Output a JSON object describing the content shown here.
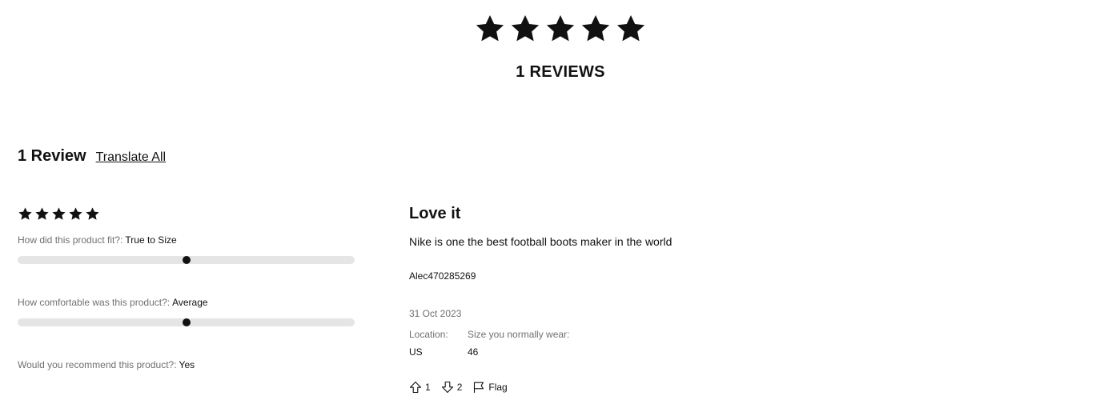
{
  "summary": {
    "rating": 5,
    "rating_max": 5,
    "count_label": "1 REVIEWS"
  },
  "reviews_section": {
    "title": "1 Review",
    "translate_all_label": "Translate All"
  },
  "review": {
    "rating": 5,
    "rating_max": 5,
    "fit_question": "How did this product fit?:",
    "fit_answer": "True to Size",
    "fit_level": 0.5,
    "comfort_question": "How comfortable was this product?:",
    "comfort_answer": "Average",
    "comfort_level": 0.5,
    "recommend_question": "Would you recommend this product?:",
    "recommend_answer": "Yes",
    "heading": "Love it",
    "body": "Nike is one the best football boots maker in the world",
    "author": "Alec470285269",
    "date": "31 Oct 2023",
    "location_label": "Location:",
    "location_value": "US",
    "size_label": "Size you normally wear:",
    "size_value": "46",
    "helpful_count": "1",
    "unhelpful_count": "2",
    "flag_label": "Flag"
  },
  "icons": {
    "star": "star-icon",
    "thumbs_up": "arrow-up-icon",
    "thumbs_down": "arrow-down-icon",
    "flag": "flag-icon"
  },
  "colors": {
    "text": "#111111",
    "muted": "#707072",
    "track": "#e5e5e5"
  }
}
